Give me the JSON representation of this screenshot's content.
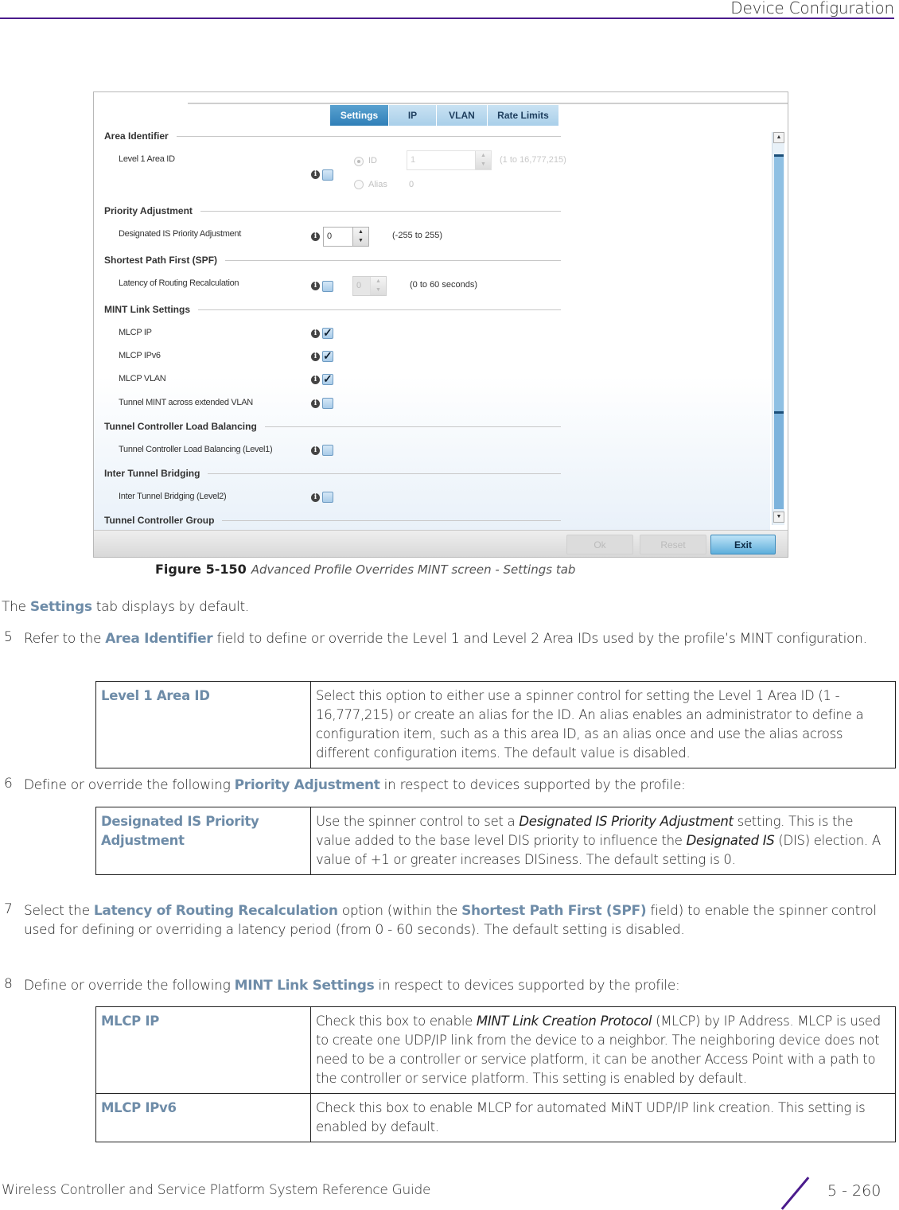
{
  "header": {
    "title": "Device Configuration"
  },
  "figure": {
    "tabs": [
      {
        "label": "Settings",
        "active": true
      },
      {
        "label": "IP",
        "active": false
      },
      {
        "label": "VLAN",
        "active": false
      },
      {
        "label": "Rate Limits",
        "active": false
      }
    ],
    "sections": {
      "area_identifier": "Area Identifier",
      "priority_adjustment": "Priority Adjustment",
      "spf": "Shortest Path First (SPF)",
      "mint_link": "MINT Link Settings",
      "tunnel_lb": "Tunnel Controller Load Balancing",
      "inter_tunnel": "Inter Tunnel Bridging",
      "tunnel_group": "Tunnel Controller Group"
    },
    "fields": {
      "level1_area_id": {
        "label": "Level 1 Area ID",
        "checked": false,
        "radio_id": "ID",
        "radio_alias": "Alias",
        "value": "1",
        "range": "(1 to 16,777,215)",
        "alias_value": "0"
      },
      "designated_is": {
        "label": "Designated IS Priority Adjustment",
        "value": "0",
        "range": "(-255 to 255)"
      },
      "latency": {
        "label": "Latency of Routing Recalculation",
        "checked": false,
        "value": "0",
        "range": "(0 to 60 seconds)"
      },
      "mlcp_ip": {
        "label": "MLCP IP",
        "checked": true
      },
      "mlcp_ipv6": {
        "label": "MLCP IPv6",
        "checked": true
      },
      "mlcp_vlan": {
        "label": "MLCP VLAN",
        "checked": true
      },
      "tunnel_mint": {
        "label": "Tunnel MINT across extended VLAN",
        "checked": false
      },
      "tunnel_lb_level1": {
        "label": "Tunnel Controller Load Balancing (Level1)",
        "checked": false
      },
      "inter_tunnel_level2": {
        "label": "Inter Tunnel Bridging (Level2)",
        "checked": false
      }
    },
    "info_icon_glyph": "i",
    "buttons": {
      "ok": "Ok",
      "reset": "Reset",
      "exit": "Exit"
    },
    "caption": {
      "number": "Figure 5-150",
      "text": "Advanced Profile Overrides MINT screen - Settings tab"
    }
  },
  "body": {
    "intro": {
      "pre": "The ",
      "hl": "Settings",
      "post": " tab displays by default."
    },
    "step5": {
      "num": "5",
      "pre": "Refer to the ",
      "hl": "Area Identifier",
      "post": " field to define or override the Level 1 and Level 2 Area IDs used by the profile’s MINT configuration."
    },
    "table1": [
      {
        "term": "Level 1 Area ID",
        "desc": "Select this option to either use a spinner control for setting the Level 1 Area ID (1 - 16,777,215) or create an alias for the ID. An alias enables an administrator to define a configuration item, such as a this area ID, as an alias once and use the alias across different configuration items. The default value is disabled."
      }
    ],
    "step6": {
      "num": "6",
      "pre": "Define or override the following ",
      "hl": "Priority Adjustment",
      "post": " in respect to devices supported by the profile:"
    },
    "table2": {
      "term": "Designated IS Priority Adjustment",
      "d1": "Use the spinner control to set a ",
      "i1": "Designated IS Priority Adjustment",
      "d2": " setting. This is the value added to the base level DIS priority to influence the ",
      "i2": "Designated IS",
      "d3": " (DIS) election. A value of +1 or greater increases DISiness. The default setting is 0."
    },
    "step7": {
      "num": "7",
      "pre": "Select the ",
      "hl1": "Latency of Routing Recalculation",
      "mid": " option (within the ",
      "hl2": "Shortest Path First (SPF)",
      "post": " field) to enable the spinner control used for defining or overriding a latency period (from 0 - 60 seconds). The default setting is disabled."
    },
    "step8": {
      "num": "8",
      "pre": "Define or override the following ",
      "hl": "MINT Link Settings",
      "post": " in respect to devices supported by the profile:"
    },
    "table3": {
      "mlcp_ip": {
        "term": "MLCP IP",
        "d1": "Check this box to enable ",
        "i1": "MINT Link Creation Protocol",
        "d2": " (MLCP) by IP Address. MLCP is used to create one UDP/IP link from the device to a neighbor. The neighboring device does not need to be a controller or service platform, it can be another Access Point with a path to the controller or service platform. This setting is enabled by default."
      },
      "mlcp_ipv6": {
        "term": "MLCP IPv6",
        "desc": "Check this box to enable MLCP for automated MiNT UDP/IP link creation. This setting is enabled by default."
      }
    }
  },
  "footer": {
    "guide_title": "Wireless Controller and Service Platform System Reference Guide",
    "page": "5 - 260"
  },
  "colors": {
    "accent_purple": "#4b1b8c",
    "term_blue": "#6e8ca8",
    "tab_active": "#2f7fb8"
  }
}
